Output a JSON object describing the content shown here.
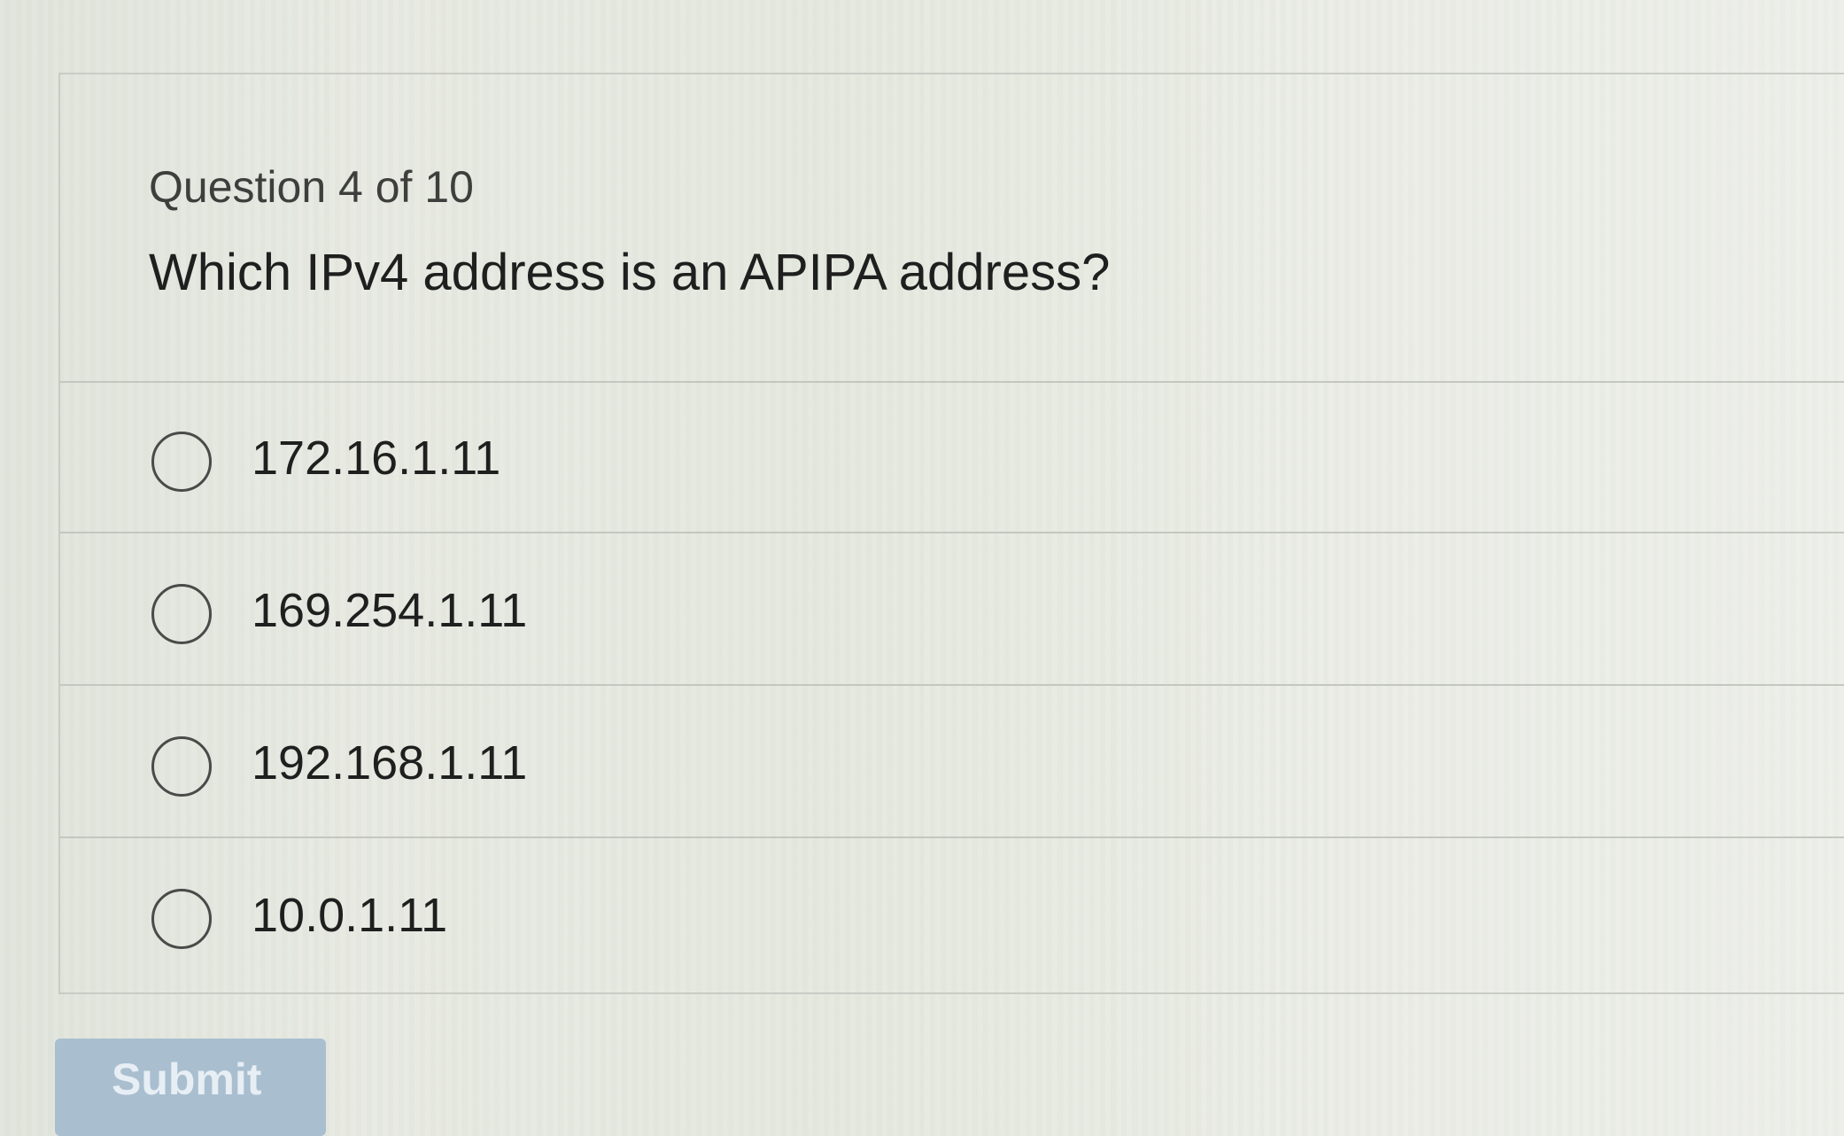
{
  "question": {
    "counter": "Question 4 of 10",
    "text": "Which IPv4 address is an APIPA address?"
  },
  "options": [
    {
      "label": "172.16.1.11",
      "selected": false
    },
    {
      "label": "169.254.1.11",
      "selected": false
    },
    {
      "label": "192.168.1.11",
      "selected": false
    },
    {
      "label": "10.0.1.11",
      "selected": false
    }
  ],
  "submit": {
    "label": "Submit",
    "state": "disabled"
  },
  "colors": {
    "submit_background": "#a9bfd0",
    "text": "#1e1f1e",
    "divider": "#c4c6c0"
  }
}
